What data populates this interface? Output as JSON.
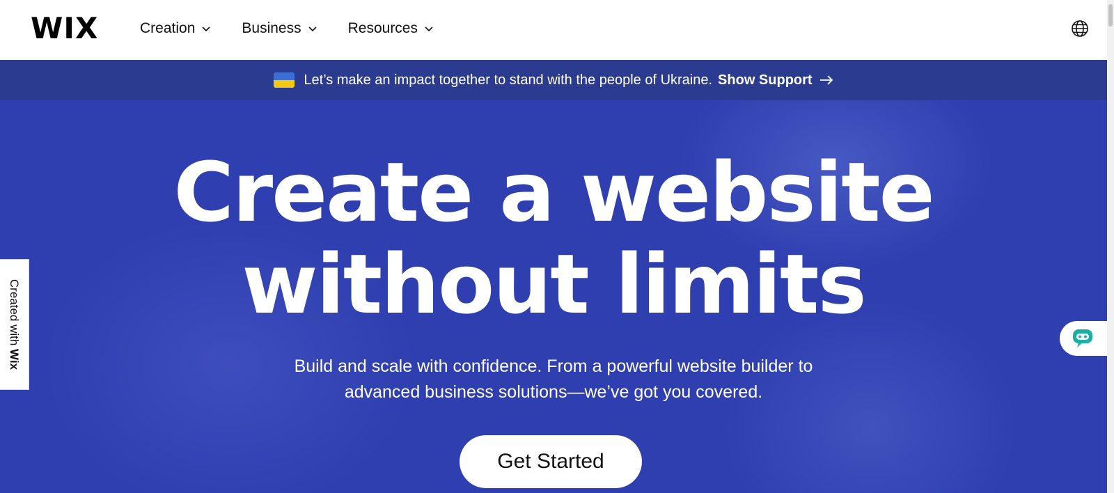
{
  "header": {
    "logo": "WIX",
    "nav": [
      {
        "label": "Creation"
      },
      {
        "label": "Business"
      },
      {
        "label": "Resources"
      }
    ],
    "globe_icon": "globe-icon"
  },
  "banner": {
    "text": "Let’s make an impact together to stand with the people of Ukraine.",
    "link_label": "Show Support",
    "flag_colors": [
      "#3b6fd6",
      "#f6c713"
    ]
  },
  "hero": {
    "headline_line1": "Create a website",
    "headline_line2": "without limits",
    "subtitle_line1": "Build and scale with confidence. From a powerful website builder to",
    "subtitle_line2": "advanced business solutions—we’ve got you covered.",
    "cta_label": "Get Started",
    "background_color": "#2f3fb0"
  },
  "side_tab": {
    "prefix": "Created with ",
    "brand": "Wix"
  },
  "chat": {
    "icon": "chat-bot-icon",
    "color": "#1bb0a6"
  }
}
